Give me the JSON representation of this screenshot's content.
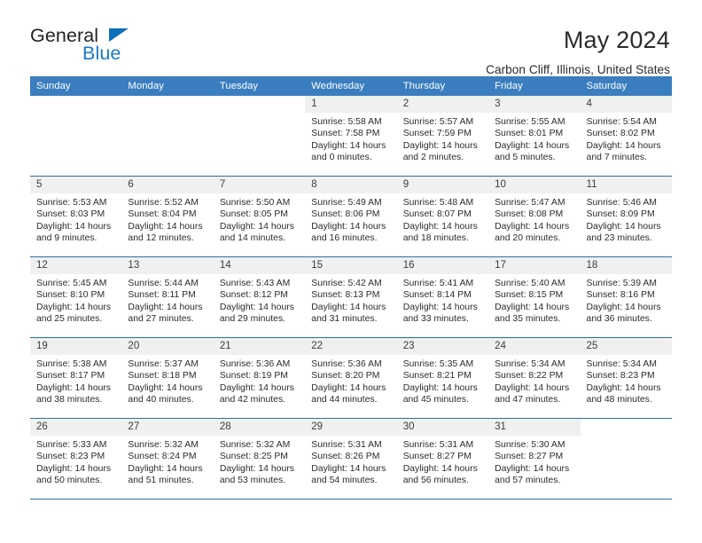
{
  "brand": {
    "name_part1": "General",
    "name_part2": "Blue",
    "triangle_color": "#0b6fba",
    "blue_color": "#1878c8"
  },
  "header": {
    "month_title": "May 2024",
    "location": "Carbon Cliff, Illinois, United States"
  },
  "theme": {
    "header_bg": "#3a7ebf",
    "row_divider": "#2e6da4",
    "daynum_bg": "#f0f0f0",
    "text": "#2b2b2b"
  },
  "calendar": {
    "weekday_headers": [
      "Sunday",
      "Monday",
      "Tuesday",
      "Wednesday",
      "Thursday",
      "Friday",
      "Saturday"
    ],
    "labels": {
      "sunrise": "Sunrise:",
      "sunset": "Sunset:",
      "daylight": "Daylight:"
    },
    "weeks": [
      [
        {
          "day": "",
          "blank": true
        },
        {
          "day": "",
          "blank": true
        },
        {
          "day": "",
          "blank": true
        },
        {
          "day": "1",
          "sunrise": "Sunrise: 5:58 AM",
          "sunset": "Sunset: 7:58 PM",
          "daylight1": "Daylight: 14 hours",
          "daylight2": "and 0 minutes."
        },
        {
          "day": "2",
          "sunrise": "Sunrise: 5:57 AM",
          "sunset": "Sunset: 7:59 PM",
          "daylight1": "Daylight: 14 hours",
          "daylight2": "and 2 minutes."
        },
        {
          "day": "3",
          "sunrise": "Sunrise: 5:55 AM",
          "sunset": "Sunset: 8:01 PM",
          "daylight1": "Daylight: 14 hours",
          "daylight2": "and 5 minutes."
        },
        {
          "day": "4",
          "sunrise": "Sunrise: 5:54 AM",
          "sunset": "Sunset: 8:02 PM",
          "daylight1": "Daylight: 14 hours",
          "daylight2": "and 7 minutes."
        }
      ],
      [
        {
          "day": "5",
          "sunrise": "Sunrise: 5:53 AM",
          "sunset": "Sunset: 8:03 PM",
          "daylight1": "Daylight: 14 hours",
          "daylight2": "and 9 minutes."
        },
        {
          "day": "6",
          "sunrise": "Sunrise: 5:52 AM",
          "sunset": "Sunset: 8:04 PM",
          "daylight1": "Daylight: 14 hours",
          "daylight2": "and 12 minutes."
        },
        {
          "day": "7",
          "sunrise": "Sunrise: 5:50 AM",
          "sunset": "Sunset: 8:05 PM",
          "daylight1": "Daylight: 14 hours",
          "daylight2": "and 14 minutes."
        },
        {
          "day": "8",
          "sunrise": "Sunrise: 5:49 AM",
          "sunset": "Sunset: 8:06 PM",
          "daylight1": "Daylight: 14 hours",
          "daylight2": "and 16 minutes."
        },
        {
          "day": "9",
          "sunrise": "Sunrise: 5:48 AM",
          "sunset": "Sunset: 8:07 PM",
          "daylight1": "Daylight: 14 hours",
          "daylight2": "and 18 minutes."
        },
        {
          "day": "10",
          "sunrise": "Sunrise: 5:47 AM",
          "sunset": "Sunset: 8:08 PM",
          "daylight1": "Daylight: 14 hours",
          "daylight2": "and 20 minutes."
        },
        {
          "day": "11",
          "sunrise": "Sunrise: 5:46 AM",
          "sunset": "Sunset: 8:09 PM",
          "daylight1": "Daylight: 14 hours",
          "daylight2": "and 23 minutes."
        }
      ],
      [
        {
          "day": "12",
          "sunrise": "Sunrise: 5:45 AM",
          "sunset": "Sunset: 8:10 PM",
          "daylight1": "Daylight: 14 hours",
          "daylight2": "and 25 minutes."
        },
        {
          "day": "13",
          "sunrise": "Sunrise: 5:44 AM",
          "sunset": "Sunset: 8:11 PM",
          "daylight1": "Daylight: 14 hours",
          "daylight2": "and 27 minutes."
        },
        {
          "day": "14",
          "sunrise": "Sunrise: 5:43 AM",
          "sunset": "Sunset: 8:12 PM",
          "daylight1": "Daylight: 14 hours",
          "daylight2": "and 29 minutes."
        },
        {
          "day": "15",
          "sunrise": "Sunrise: 5:42 AM",
          "sunset": "Sunset: 8:13 PM",
          "daylight1": "Daylight: 14 hours",
          "daylight2": "and 31 minutes."
        },
        {
          "day": "16",
          "sunrise": "Sunrise: 5:41 AM",
          "sunset": "Sunset: 8:14 PM",
          "daylight1": "Daylight: 14 hours",
          "daylight2": "and 33 minutes."
        },
        {
          "day": "17",
          "sunrise": "Sunrise: 5:40 AM",
          "sunset": "Sunset: 8:15 PM",
          "daylight1": "Daylight: 14 hours",
          "daylight2": "and 35 minutes."
        },
        {
          "day": "18",
          "sunrise": "Sunrise: 5:39 AM",
          "sunset": "Sunset: 8:16 PM",
          "daylight1": "Daylight: 14 hours",
          "daylight2": "and 36 minutes."
        }
      ],
      [
        {
          "day": "19",
          "sunrise": "Sunrise: 5:38 AM",
          "sunset": "Sunset: 8:17 PM",
          "daylight1": "Daylight: 14 hours",
          "daylight2": "and 38 minutes."
        },
        {
          "day": "20",
          "sunrise": "Sunrise: 5:37 AM",
          "sunset": "Sunset: 8:18 PM",
          "daylight1": "Daylight: 14 hours",
          "daylight2": "and 40 minutes."
        },
        {
          "day": "21",
          "sunrise": "Sunrise: 5:36 AM",
          "sunset": "Sunset: 8:19 PM",
          "daylight1": "Daylight: 14 hours",
          "daylight2": "and 42 minutes."
        },
        {
          "day": "22",
          "sunrise": "Sunrise: 5:36 AM",
          "sunset": "Sunset: 8:20 PM",
          "daylight1": "Daylight: 14 hours",
          "daylight2": "and 44 minutes."
        },
        {
          "day": "23",
          "sunrise": "Sunrise: 5:35 AM",
          "sunset": "Sunset: 8:21 PM",
          "daylight1": "Daylight: 14 hours",
          "daylight2": "and 45 minutes."
        },
        {
          "day": "24",
          "sunrise": "Sunrise: 5:34 AM",
          "sunset": "Sunset: 8:22 PM",
          "daylight1": "Daylight: 14 hours",
          "daylight2": "and 47 minutes."
        },
        {
          "day": "25",
          "sunrise": "Sunrise: 5:34 AM",
          "sunset": "Sunset: 8:23 PM",
          "daylight1": "Daylight: 14 hours",
          "daylight2": "and 48 minutes."
        }
      ],
      [
        {
          "day": "26",
          "sunrise": "Sunrise: 5:33 AM",
          "sunset": "Sunset: 8:23 PM",
          "daylight1": "Daylight: 14 hours",
          "daylight2": "and 50 minutes."
        },
        {
          "day": "27",
          "sunrise": "Sunrise: 5:32 AM",
          "sunset": "Sunset: 8:24 PM",
          "daylight1": "Daylight: 14 hours",
          "daylight2": "and 51 minutes."
        },
        {
          "day": "28",
          "sunrise": "Sunrise: 5:32 AM",
          "sunset": "Sunset: 8:25 PM",
          "daylight1": "Daylight: 14 hours",
          "daylight2": "and 53 minutes."
        },
        {
          "day": "29",
          "sunrise": "Sunrise: 5:31 AM",
          "sunset": "Sunset: 8:26 PM",
          "daylight1": "Daylight: 14 hours",
          "daylight2": "and 54 minutes."
        },
        {
          "day": "30",
          "sunrise": "Sunrise: 5:31 AM",
          "sunset": "Sunset: 8:27 PM",
          "daylight1": "Daylight: 14 hours",
          "daylight2": "and 56 minutes."
        },
        {
          "day": "31",
          "sunrise": "Sunrise: 5:30 AM",
          "sunset": "Sunset: 8:27 PM",
          "daylight1": "Daylight: 14 hours",
          "daylight2": "and 57 minutes."
        },
        {
          "day": "",
          "blank": true
        }
      ]
    ]
  }
}
